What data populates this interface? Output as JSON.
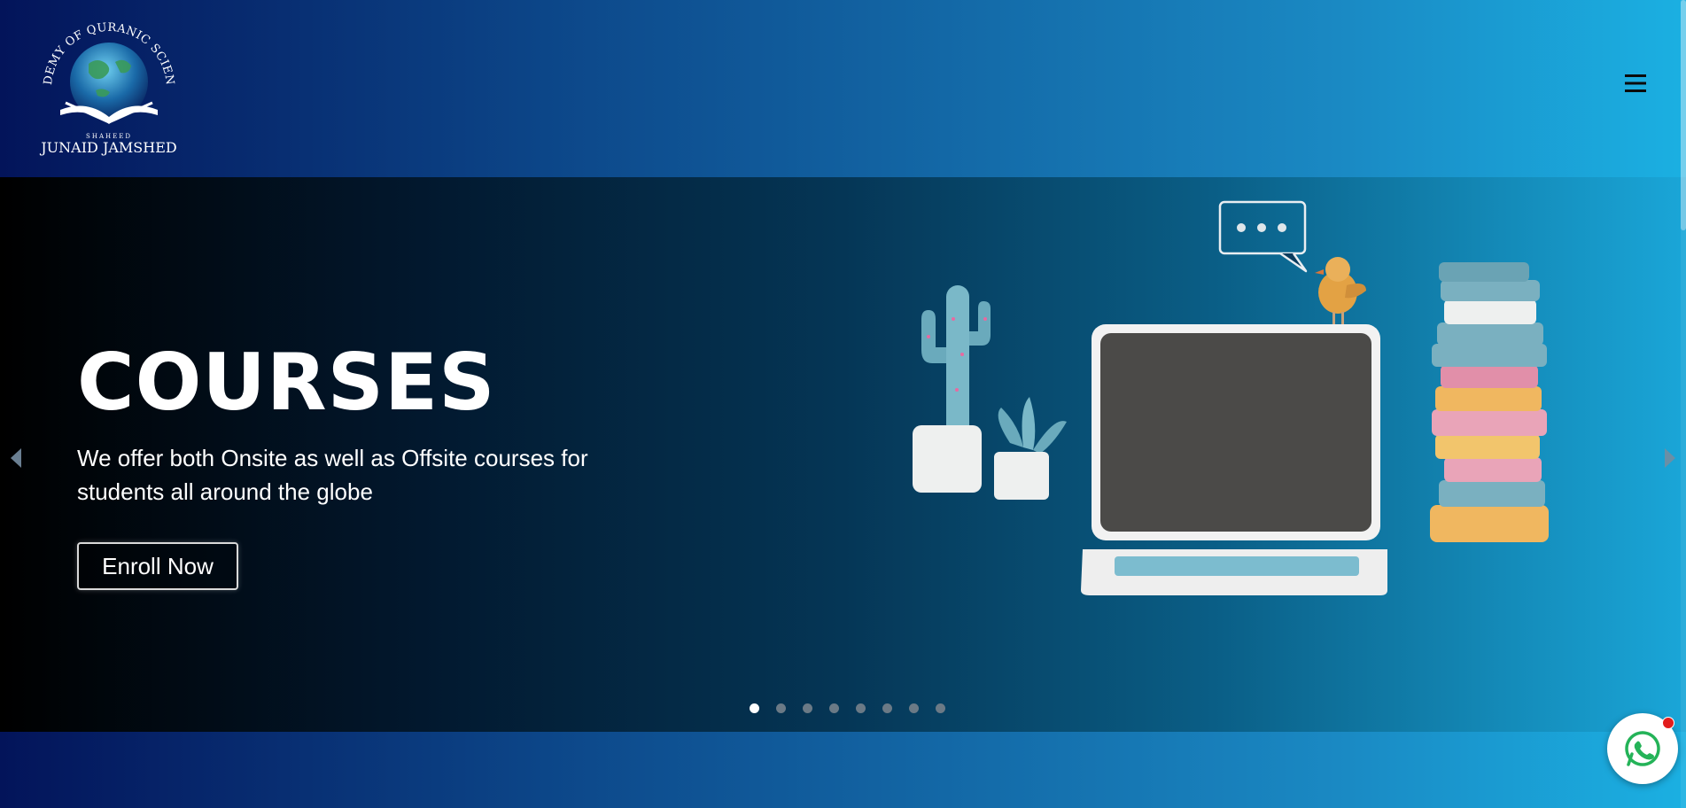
{
  "site": {
    "logo_top_text": "ACADEMY OF QURANIC SCIENCES",
    "logo_small_text": "SHAHEED",
    "logo_bottom_text": "JUNAID JAMSHED"
  },
  "header": {
    "menu_icon": "hamburger-icon"
  },
  "hero": {
    "title": "COURSES",
    "subtitle": "We offer both Onsite as well as Offsite courses for students all around the globe",
    "cta_label": "Enroll Now",
    "slides": [
      {
        "active": true
      },
      {
        "active": false
      },
      {
        "active": false
      },
      {
        "active": false
      },
      {
        "active": false
      },
      {
        "active": false
      },
      {
        "active": false
      },
      {
        "active": false
      }
    ]
  },
  "colors": {
    "header_start": "#03145a",
    "header_end": "#1bb0e2",
    "accent_white": "#ffffff",
    "notification_red": "#e21d1d"
  }
}
